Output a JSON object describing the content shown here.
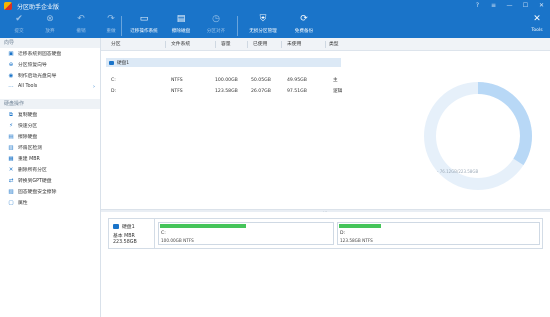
{
  "app": {
    "title": "分区助手企业版"
  },
  "toolbar": {
    "commit": "提交",
    "discard": "放弃",
    "undo": "撤销",
    "redo": "重做",
    "migrate_os": "迁移操作系统",
    "wipe_disk": "擦除磁盘",
    "align_partition": "分区对齐",
    "lossless_partition": "无损分区管理",
    "free_backup": "免费备份",
    "tools": "Tools"
  },
  "sidebar": {
    "wizards_head": "向导",
    "wizards": [
      {
        "label": "迁移系统到固态硬盘",
        "icon": "migrate-icon"
      },
      {
        "label": "分区恢复向导",
        "icon": "recovery-icon"
      },
      {
        "label": "制作启动光盘向导",
        "icon": "bootdisk-icon"
      },
      {
        "label": "All Tools",
        "icon": "tools-icon"
      }
    ],
    "disk_ops_head": "硬盘操作",
    "disk_ops": [
      {
        "label": "复制硬盘",
        "icon": "copy-disk-icon"
      },
      {
        "label": "快速分区",
        "icon": "quick-partition-icon"
      },
      {
        "label": "擦除硬盘",
        "icon": "wipe-icon"
      },
      {
        "label": "坏扇区检测",
        "icon": "check-icon"
      },
      {
        "label": "重建 MBR",
        "icon": "rebuild-icon"
      },
      {
        "label": "删除所有分区",
        "icon": "delete-all-icon"
      },
      {
        "label": "转换到GPT硬盘",
        "icon": "convert-icon"
      },
      {
        "label": "固态硬盘安全擦除",
        "icon": "ssd-erase-icon"
      },
      {
        "label": "属性",
        "icon": "properties-icon"
      }
    ]
  },
  "table": {
    "headers": [
      "分区",
      "文件系统",
      "容量",
      "已使用",
      "未使用",
      "类型"
    ],
    "disk_label": "硬盘1",
    "rows": [
      {
        "partition": "C:",
        "fs": "NTFS",
        "capacity": "100.00GB",
        "used": "50.05GB",
        "free": "49.95GB",
        "type": "主"
      },
      {
        "partition": "D:",
        "fs": "NTFS",
        "capacity": "123.58GB",
        "used": "26.07GB",
        "free": "97.51GB",
        "type": "逻辑"
      }
    ]
  },
  "chart": {
    "caption": "- 76.12GB/223.58GB",
    "used_fraction": 0.34,
    "used_color": "#b8d8f6",
    "free_color": "#e6f0fa"
  },
  "disk_map": {
    "name": "硬盘1",
    "type": "基本 MBR",
    "size": "223.58GB",
    "partitions": [
      {
        "name": "C:",
        "info": "100.00GB NTFS",
        "used_fraction": 0.5
      },
      {
        "name": "D:",
        "info": "123.58GB NTFS",
        "used_fraction": 0.21
      }
    ],
    "bar_color": "#45c45a"
  },
  "colors": {
    "accent": "#1a74c9"
  }
}
